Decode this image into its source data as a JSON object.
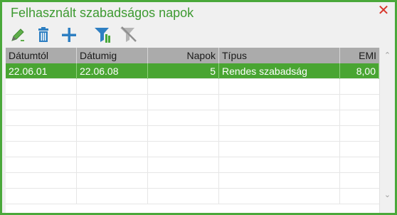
{
  "window": {
    "title": "Felhasznált szabadságos napok",
    "close_icon": "close-icon"
  },
  "toolbar": {
    "buttons": [
      {
        "name": "edit-button",
        "icon": "pencil-icon"
      },
      {
        "name": "delete-button",
        "icon": "trash-icon"
      },
      {
        "name": "add-button",
        "icon": "plus-icon"
      },
      {
        "name": "filter-button",
        "icon": "filter-icon"
      },
      {
        "name": "clear-filter-button",
        "icon": "filter-off-icon"
      }
    ]
  },
  "grid": {
    "columns": [
      "Dátumtól",
      "Dátumig",
      "Napok",
      "Típus",
      "EMI"
    ],
    "rows": [
      [
        "22.06.01",
        "22.06.08",
        "5",
        "Rendes szabadság",
        "8,00"
      ]
    ]
  },
  "colors": {
    "accent": "#4aa83a",
    "selected_row": "#49a532",
    "header_bg": "#ababab",
    "close": "#d8352a"
  }
}
